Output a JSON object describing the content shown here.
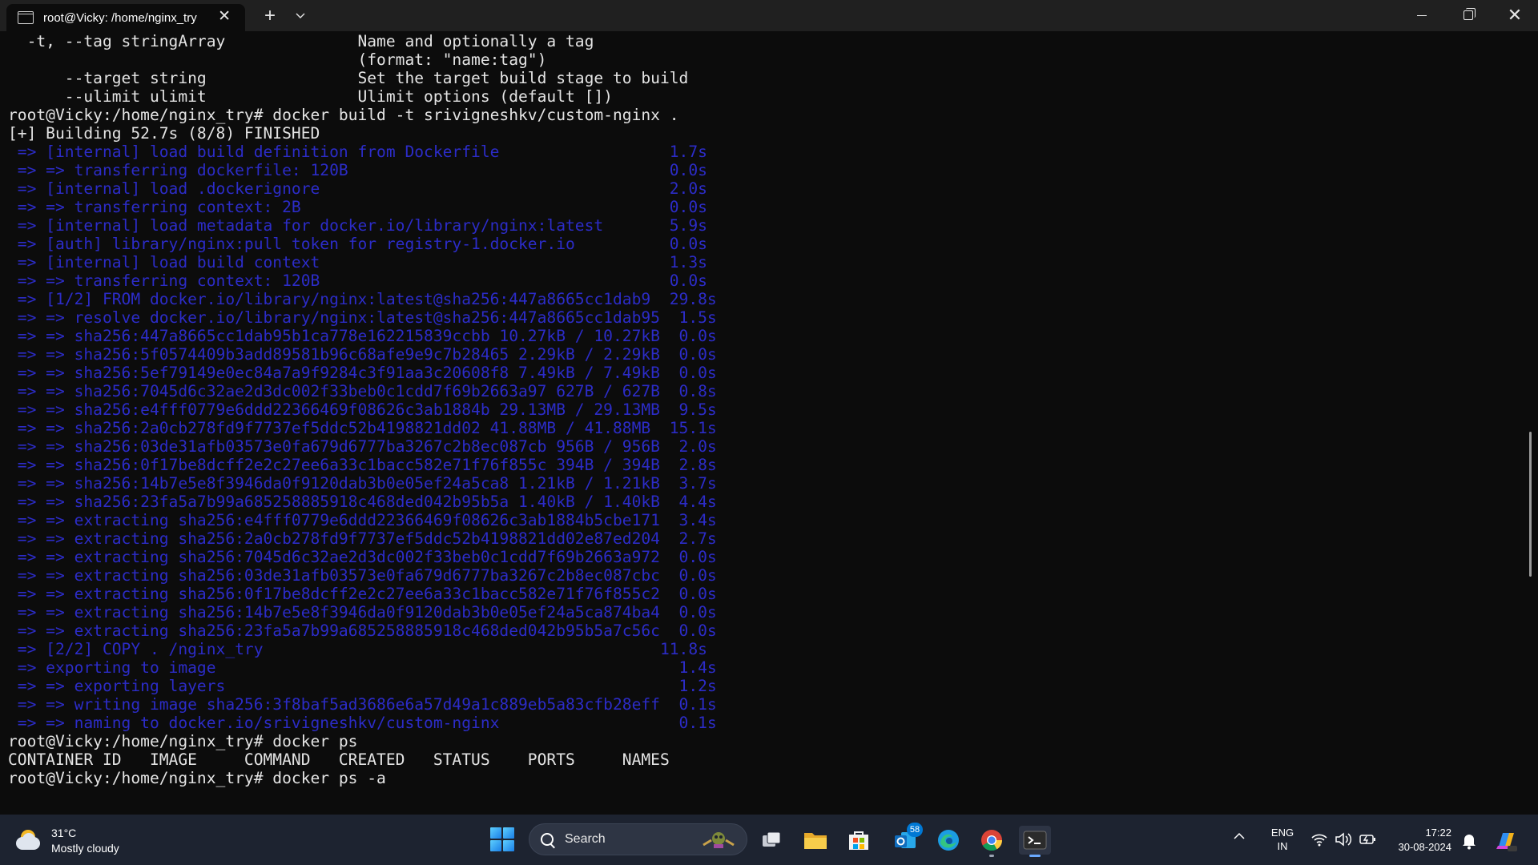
{
  "window": {
    "tab_title": "root@Vicky: /home/nginx_try",
    "tab_close": "✕",
    "new_tab": "+",
    "dropdown": "⌄",
    "close": "✕"
  },
  "terminal": {
    "lines": [
      {
        "text": "  -t, --tag stringArray              Name and optionally a tag",
        "color": "#e4e4e4"
      },
      {
        "text": "                                     (format: \"name:tag\")",
        "color": "#e4e4e4"
      },
      {
        "text": "      --target string                Set the target build stage to build",
        "color": "#e4e4e4"
      },
      {
        "text": "      --ulimit ulimit                Ulimit options (default [])",
        "color": "#e4e4e4"
      },
      {
        "text": "root@Vicky:/home/nginx_try# docker build -t srivigneshkv/custom-nginx .",
        "color": "#e4e4e4"
      },
      {
        "text": "[+] Building 52.7s (8/8) FINISHED",
        "color": "#e4e4e4"
      },
      {
        "text": " => [internal] load build definition from Dockerfile                  1.7s",
        "color": "#2c2cc8"
      },
      {
        "text": " => => transferring dockerfile: 120B                                  0.0s",
        "color": "#2c2cc8"
      },
      {
        "text": " => [internal] load .dockerignore                                     2.0s",
        "color": "#2c2cc8"
      },
      {
        "text": " => => transferring context: 2B                                       0.0s",
        "color": "#2c2cc8"
      },
      {
        "text": " => [internal] load metadata for docker.io/library/nginx:latest       5.9s",
        "color": "#2c2cc8"
      },
      {
        "text": " => [auth] library/nginx:pull token for registry-1.docker.io          0.0s",
        "color": "#2c2cc8"
      },
      {
        "text": " => [internal] load build context                                     1.3s",
        "color": "#2c2cc8"
      },
      {
        "text": " => => transferring context: 120B                                     0.0s",
        "color": "#2c2cc8"
      },
      {
        "text": " => [1/2] FROM docker.io/library/nginx:latest@sha256:447a8665cc1dab9  29.8s",
        "color": "#2c2cc8"
      },
      {
        "text": " => => resolve docker.io/library/nginx:latest@sha256:447a8665cc1dab95  1.5s",
        "color": "#2c2cc8"
      },
      {
        "text": " => => sha256:447a8665cc1dab95b1ca778e162215839ccbb 10.27kB / 10.27kB  0.0s",
        "color": "#2c2cc8"
      },
      {
        "text": " => => sha256:5f0574409b3add89581b96c68afe9e9c7b28465 2.29kB / 2.29kB  0.0s",
        "color": "#2c2cc8"
      },
      {
        "text": " => => sha256:5ef79149e0ec84a7a9f9284c3f91aa3c20608f8 7.49kB / 7.49kB  0.0s",
        "color": "#2c2cc8"
      },
      {
        "text": " => => sha256:7045d6c32ae2d3dc002f33beb0c1cdd7f69b2663a97 627B / 627B  0.8s",
        "color": "#2c2cc8"
      },
      {
        "text": " => => sha256:e4fff0779e6ddd22366469f08626c3ab1884b 29.13MB / 29.13MB  9.5s",
        "color": "#2c2cc8"
      },
      {
        "text": " => => sha256:2a0cb278fd9f7737ef5ddc52b4198821dd02 41.88MB / 41.88MB  15.1s",
        "color": "#2c2cc8"
      },
      {
        "text": " => => sha256:03de31afb03573e0fa679d6777ba3267c2b8ec087cb 956B / 956B  2.0s",
        "color": "#2c2cc8"
      },
      {
        "text": " => => sha256:0f17be8dcff2e2c27ee6a33c1bacc582e71f76f855c 394B / 394B  2.8s",
        "color": "#2c2cc8"
      },
      {
        "text": " => => sha256:14b7e5e8f3946da0f9120dab3b0e05ef24a5ca8 1.21kB / 1.21kB  3.7s",
        "color": "#2c2cc8"
      },
      {
        "text": " => => sha256:23fa5a7b99a685258885918c468ded042b95b5a 1.40kB / 1.40kB  4.4s",
        "color": "#2c2cc8"
      },
      {
        "text": " => => extracting sha256:e4fff0779e6ddd22366469f08626c3ab1884b5cbe171  3.4s",
        "color": "#2c2cc8"
      },
      {
        "text": " => => extracting sha256:2a0cb278fd9f7737ef5ddc52b4198821dd02e87ed204  2.7s",
        "color": "#2c2cc8"
      },
      {
        "text": " => => extracting sha256:7045d6c32ae2d3dc002f33beb0c1cdd7f69b2663a972  0.0s",
        "color": "#2c2cc8"
      },
      {
        "text": " => => extracting sha256:03de31afb03573e0fa679d6777ba3267c2b8ec087cbc  0.0s",
        "color": "#2c2cc8"
      },
      {
        "text": " => => extracting sha256:0f17be8dcff2e2c27ee6a33c1bacc582e71f76f855c2  0.0s",
        "color": "#2c2cc8"
      },
      {
        "text": " => => extracting sha256:14b7e5e8f3946da0f9120dab3b0e05ef24a5ca874ba4  0.0s",
        "color": "#2c2cc8"
      },
      {
        "text": " => => extracting sha256:23fa5a7b99a685258885918c468ded042b95b5a7c56c  0.0s",
        "color": "#2c2cc8"
      },
      {
        "text": " => [2/2] COPY . /nginx_try                                          11.8s",
        "color": "#2c2cc8"
      },
      {
        "text": " => exporting to image                                                 1.4s",
        "color": "#2c2cc8"
      },
      {
        "text": " => => exporting layers                                                1.2s",
        "color": "#2c2cc8"
      },
      {
        "text": " => => writing image sha256:3f8baf5ad3686e6a57d49a1c889eb5a83cfb28eff  0.1s",
        "color": "#2c2cc8"
      },
      {
        "text": " => => naming to docker.io/srivigneshkv/custom-nginx                   0.1s",
        "color": "#2c2cc8"
      },
      {
        "text": "root@Vicky:/home/nginx_try# docker ps",
        "color": "#e4e4e4"
      },
      {
        "text": "CONTAINER ID   IMAGE     COMMAND   CREATED   STATUS    PORTS     NAMES",
        "color": "#e4e4e4"
      },
      {
        "text": "root@Vicky:/home/nginx_try# docker ps -a",
        "color": "#e4e4e4"
      }
    ]
  },
  "taskbar": {
    "weather": {
      "temp": "31°C",
      "condition": "Mostly cloudy"
    },
    "search_label": "Search",
    "outlook_badge": "58",
    "language": {
      "line1": "ENG",
      "line2": "IN"
    },
    "clock": {
      "time": "17:22",
      "date": "30-08-2024"
    },
    "tray_chevron": "^"
  },
  "colors": {
    "terminal_bg": "#0c0c0c",
    "terminal_fg": "#e4e4e4",
    "docker_blue": "#2c2cc8",
    "titlebar_bg": "#202020",
    "taskbar_bg": "#1d2330"
  }
}
